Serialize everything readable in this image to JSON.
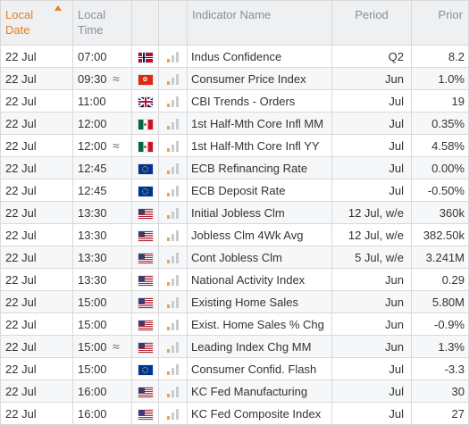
{
  "headers": {
    "local_date": "Local\nDate",
    "local_time": "Local\nTime",
    "indicator": "Indicator Name",
    "period": "Period",
    "prior": "Prior"
  },
  "rows": [
    {
      "date": "22 Jul",
      "time": "07:00",
      "approx": "",
      "flag": "norway-flag-icon",
      "flag_class": "no",
      "name": "Indus Confidence",
      "period": "Q2",
      "prior": "8.2"
    },
    {
      "date": "22 Jul",
      "time": "09:30",
      "approx": "≈",
      "flag": "hong-kong-flag-icon",
      "flag_class": "hk",
      "name": "Consumer Price Index",
      "period": "Jun",
      "prior": "1.0%"
    },
    {
      "date": "22 Jul",
      "time": "11:00",
      "approx": "",
      "flag": "uk-flag-icon",
      "flag_class": "gb",
      "name": "CBI Trends - Orders",
      "period": "Jul",
      "prior": "19"
    },
    {
      "date": "22 Jul",
      "time": "12:00",
      "approx": "",
      "flag": "mexico-flag-icon",
      "flag_class": "mx",
      "name": "1st Half-Mth Core Infl MM",
      "period": "Jul",
      "prior": "0.35%"
    },
    {
      "date": "22 Jul",
      "time": "12:00",
      "approx": "≈",
      "flag": "mexico-flag-icon",
      "flag_class": "mx",
      "name": "1st Half-Mth Core Infl YY",
      "period": "Jul",
      "prior": "4.58%"
    },
    {
      "date": "22 Jul",
      "time": "12:45",
      "approx": "",
      "flag": "eu-flag-icon",
      "flag_class": "eu",
      "name": "ECB Refinancing Rate",
      "period": "Jul",
      "prior": "0.00%"
    },
    {
      "date": "22 Jul",
      "time": "12:45",
      "approx": "",
      "flag": "eu-flag-icon",
      "flag_class": "eu",
      "name": "ECB Deposit Rate",
      "period": "Jul",
      "prior": "-0.50%"
    },
    {
      "date": "22 Jul",
      "time": "13:30",
      "approx": "",
      "flag": "us-flag-icon",
      "flag_class": "us",
      "name": "Initial Jobless Clm",
      "period": "12 Jul, w/e",
      "prior": "360k"
    },
    {
      "date": "22 Jul",
      "time": "13:30",
      "approx": "",
      "flag": "us-flag-icon",
      "flag_class": "us",
      "name": "Jobless Clm 4Wk Avg",
      "period": "12 Jul, w/e",
      "prior": "382.50k"
    },
    {
      "date": "22 Jul",
      "time": "13:30",
      "approx": "",
      "flag": "us-flag-icon",
      "flag_class": "us",
      "name": "Cont Jobless Clm",
      "period": "5 Jul, w/e",
      "prior": "3.241M"
    },
    {
      "date": "22 Jul",
      "time": "13:30",
      "approx": "",
      "flag": "us-flag-icon",
      "flag_class": "us",
      "name": "National Activity Index",
      "period": "Jun",
      "prior": "0.29"
    },
    {
      "date": "22 Jul",
      "time": "15:00",
      "approx": "",
      "flag": "us-flag-icon",
      "flag_class": "us",
      "name": "Existing Home Sales",
      "period": "Jun",
      "prior": "5.80M"
    },
    {
      "date": "22 Jul",
      "time": "15:00",
      "approx": "",
      "flag": "us-flag-icon",
      "flag_class": "us",
      "name": "Exist. Home Sales % Chg",
      "period": "Jun",
      "prior": "-0.9%"
    },
    {
      "date": "22 Jul",
      "time": "15:00",
      "approx": "≈",
      "flag": "us-flag-icon",
      "flag_class": "us",
      "name": "Leading Index Chg MM",
      "period": "Jun",
      "prior": "1.3%"
    },
    {
      "date": "22 Jul",
      "time": "15:00",
      "approx": "",
      "flag": "eu-flag-icon",
      "flag_class": "eu",
      "name": "Consumer Confid. Flash",
      "period": "Jul",
      "prior": "-3.3"
    },
    {
      "date": "22 Jul",
      "time": "16:00",
      "approx": "",
      "flag": "us-flag-icon",
      "flag_class": "us",
      "name": "KC Fed Manufacturing",
      "period": "Jul",
      "prior": "30"
    },
    {
      "date": "22 Jul",
      "time": "16:00",
      "approx": "",
      "flag": "us-flag-icon",
      "flag_class": "us",
      "name": "KC Fed Composite Index",
      "period": "Jul",
      "prior": "27"
    }
  ],
  "importance_icon": "signal-bars-icon",
  "colors": {
    "accent": "#e67e22",
    "header_bg": "#eef0f2",
    "header_text": "#8a8f95",
    "border": "#d9d9d9",
    "zebra": "#f6f7f8"
  }
}
